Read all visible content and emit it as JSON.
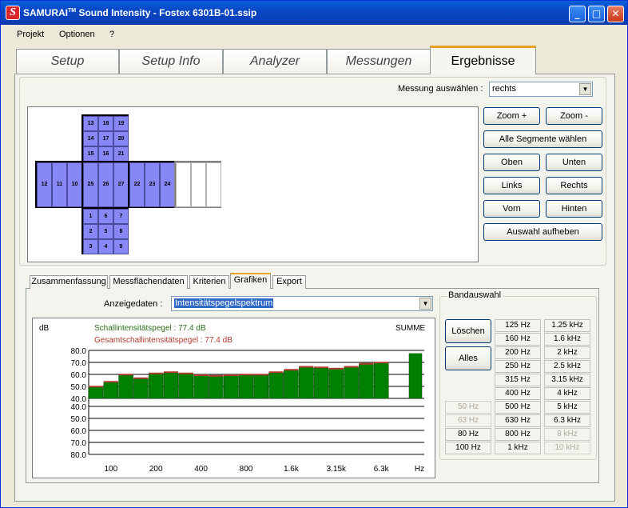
{
  "window": {
    "app_name": "SAMURAI",
    "app_mark": "TM",
    "title_rest": "Sound Intensity - Fostex 6301B-01.ssip",
    "logo_letter": "S"
  },
  "menu": [
    "Projekt",
    "Optionen",
    "?"
  ],
  "main_tabs": [
    {
      "label": "Setup"
    },
    {
      "label": "Setup Info"
    },
    {
      "label": "Analyzer"
    },
    {
      "label": "Messungen"
    },
    {
      "label": "Ergebnisse"
    }
  ],
  "measurement": {
    "label": "Messung auswählen :",
    "value": "rechts"
  },
  "cube": {
    "top": [
      [
        "13",
        "18",
        "19"
      ],
      [
        "14",
        "17",
        "20"
      ],
      [
        "15",
        "16",
        "21"
      ]
    ],
    "left": [
      "12",
      "11",
      "10"
    ],
    "front": [
      "25",
      "26",
      "27"
    ],
    "right": [
      "22",
      "23",
      "24"
    ],
    "bottom": [
      [
        "1",
        "6",
        "7"
      ],
      [
        "2",
        "5",
        "8"
      ],
      [
        "3",
        "4",
        "9"
      ]
    ]
  },
  "view_buttons": {
    "zoom_in": "Zoom +",
    "zoom_out": "Zoom -",
    "select_all": "Alle Segmente wählen",
    "top": "Oben",
    "bottom": "Unten",
    "left": "Links",
    "right": "Rechts",
    "front": "Vorn",
    "back": "Hinten",
    "clear_selection": "Auswahl aufheben"
  },
  "sub_tabs": [
    "Zusammenfassung",
    "Messflächendaten",
    "Kriterien",
    "Grafiken",
    "Export"
  ],
  "display": {
    "label": "Anzeigedaten :",
    "value": "Intensitätspegelspektrum"
  },
  "chart_data": {
    "type": "bar",
    "unit_label": "dB",
    "legend": [
      {
        "text": "Schallintensitätspegel : 77.4 dB",
        "color": "#2a6e1a"
      },
      {
        "text": "Gesamtschallintensitätspegel : 77.4 dB",
        "color": "#b03a2e"
      }
    ],
    "sum_label": "SUMME",
    "upper": {
      "ylim": [
        40,
        80
      ],
      "yticks": [
        "80.0",
        "70.0",
        "60.0",
        "50.0",
        "40.0"
      ],
      "values": [
        49.5,
        53.5,
        59.5,
        56.5,
        60.5,
        61.5,
        60.5,
        59.0,
        58.5,
        59.0,
        59.5,
        59.5,
        61.5,
        63.5,
        66.0,
        65.5,
        64.5,
        66.0,
        68.5,
        69.5
      ],
      "sum_value": 77.4,
      "bar_color": "#008000",
      "cap_color": "#b03a2e"
    },
    "lower": {
      "yticks": [
        "40.0",
        "50.0",
        "60.0",
        "70.0",
        "80.0"
      ]
    },
    "xticks": [
      "100",
      "200",
      "400",
      "800",
      "1.6k",
      "3.15k",
      "6.3k"
    ],
    "x_unit": "Hz"
  },
  "band_group": {
    "title": "Bandauswahl",
    "clear": "Löschen",
    "all": "Alles",
    "cells": [
      {
        "label": "125 Hz",
        "col": 1,
        "row": 0,
        "state": "sel"
      },
      {
        "label": "1.25 kHz",
        "col": 2,
        "row": 0,
        "state": "sel"
      },
      {
        "label": "160 Hz",
        "col": 1,
        "row": 1,
        "state": "sel"
      },
      {
        "label": "1.6 kHz",
        "col": 2,
        "row": 1,
        "state": "sel"
      },
      {
        "label": "200 Hz",
        "col": 1,
        "row": 2,
        "state": "sel"
      },
      {
        "label": "2 kHz",
        "col": 2,
        "row": 2,
        "state": "sel"
      },
      {
        "label": "250 Hz",
        "col": 1,
        "row": 3,
        "state": "sel"
      },
      {
        "label": "2.5 kHz",
        "col": 2,
        "row": 3,
        "state": "sel"
      },
      {
        "label": "315 Hz",
        "col": 1,
        "row": 4,
        "state": "sel"
      },
      {
        "label": "3.15 kHz",
        "col": 2,
        "row": 4,
        "state": "sel"
      },
      {
        "label": "400 Hz",
        "col": 1,
        "row": 5,
        "state": "sel"
      },
      {
        "label": "4 kHz",
        "col": 2,
        "row": 5,
        "state": "sel"
      },
      {
        "label": "50 Hz",
        "col": 0,
        "row": 6,
        "state": "dis"
      },
      {
        "label": "500 Hz",
        "col": 1,
        "row": 6,
        "state": "sel"
      },
      {
        "label": "5 kHz",
        "col": 2,
        "row": 6,
        "state": "sel"
      },
      {
        "label": "63 Hz",
        "col": 0,
        "row": 7,
        "state": "dis"
      },
      {
        "label": "630 Hz",
        "col": 1,
        "row": 7,
        "state": "sel"
      },
      {
        "label": "6.3 kHz",
        "col": 2,
        "row": 7,
        "state": "sel"
      },
      {
        "label": "80 Hz",
        "col": 0,
        "row": 8,
        "state": "sel"
      },
      {
        "label": "800 Hz",
        "col": 1,
        "row": 8,
        "state": "sel"
      },
      {
        "label": "8 kHz",
        "col": 2,
        "row": 8,
        "state": "dis"
      },
      {
        "label": "100 Hz",
        "col": 0,
        "row": 9,
        "state": "sel"
      },
      {
        "label": "1 kHz",
        "col": 1,
        "row": 9,
        "state": "sel"
      },
      {
        "label": "10 kHz",
        "col": 2,
        "row": 9,
        "state": "dis"
      }
    ]
  }
}
